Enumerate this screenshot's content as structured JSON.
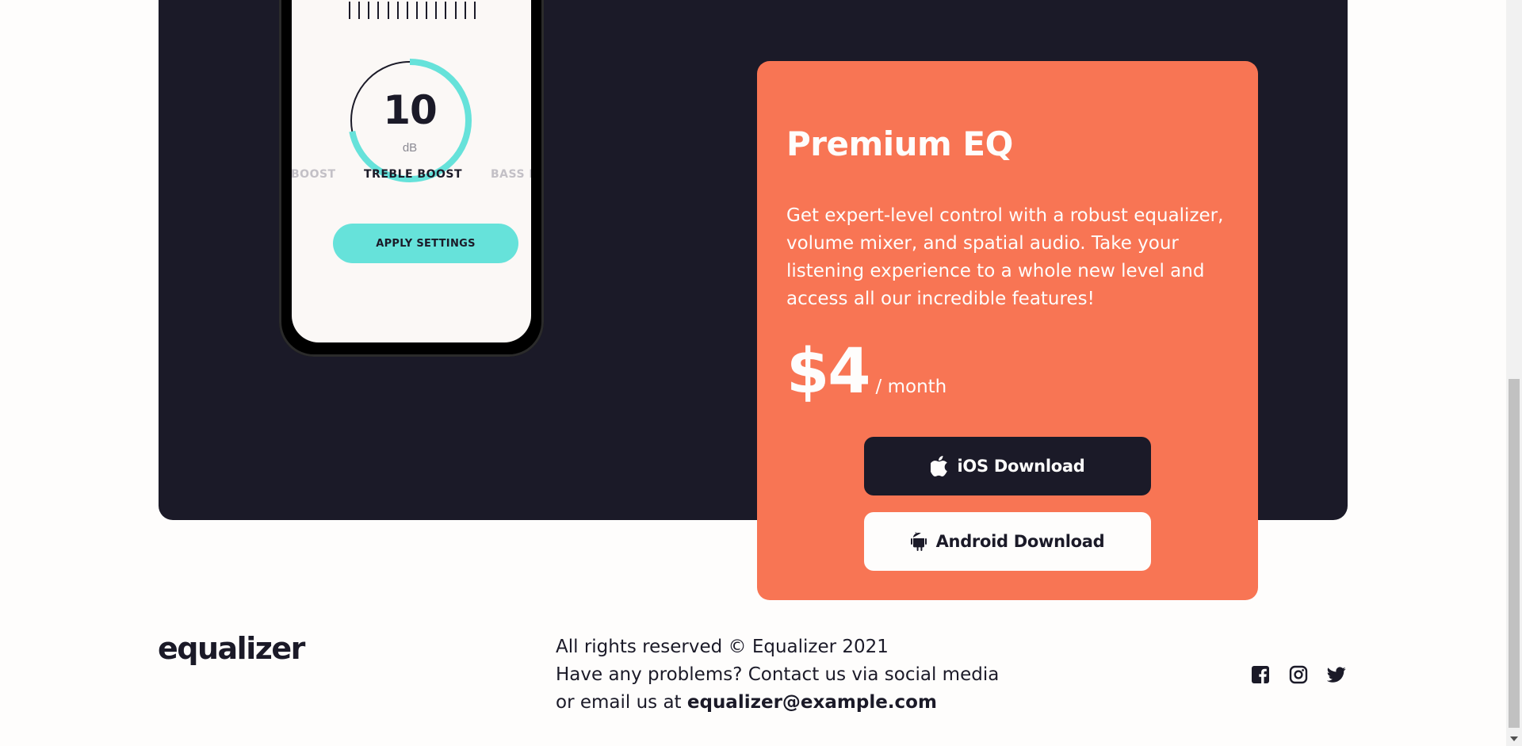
{
  "phone": {
    "dial_value": "10",
    "dial_unit": "dB",
    "dial_level": 0.72,
    "presets": {
      "left": "BOOST",
      "active": "TREBLE BOOST",
      "right": "BASS B"
    },
    "apply_label": "APPLY SETTINGS",
    "accent": "#66e2da"
  },
  "card": {
    "title": "Premium EQ",
    "description": "Get expert-level control with a robust equalizer, volume mixer, and spatial audio. Take your listening experience to a whole new level and access all our incredible features!",
    "price": "$4",
    "period": "/ month",
    "ios_label": "iOS Download",
    "android_label": "Android Download",
    "ios_icon": "apple-icon",
    "android_icon": "android-icon",
    "color": "#f87554"
  },
  "footer": {
    "logo": "equalizer",
    "line1": "All rights reserved © Equalizer 2021",
    "line2": "Have any problems? Contact us via social media",
    "line3_prefix": "or email us at ",
    "email": "equalizer@example.com",
    "social_icons": [
      "facebook-icon",
      "instagram-icon",
      "twitter-icon"
    ]
  },
  "colors": {
    "dark": "#1b1a28",
    "light": "#fefdfc"
  }
}
